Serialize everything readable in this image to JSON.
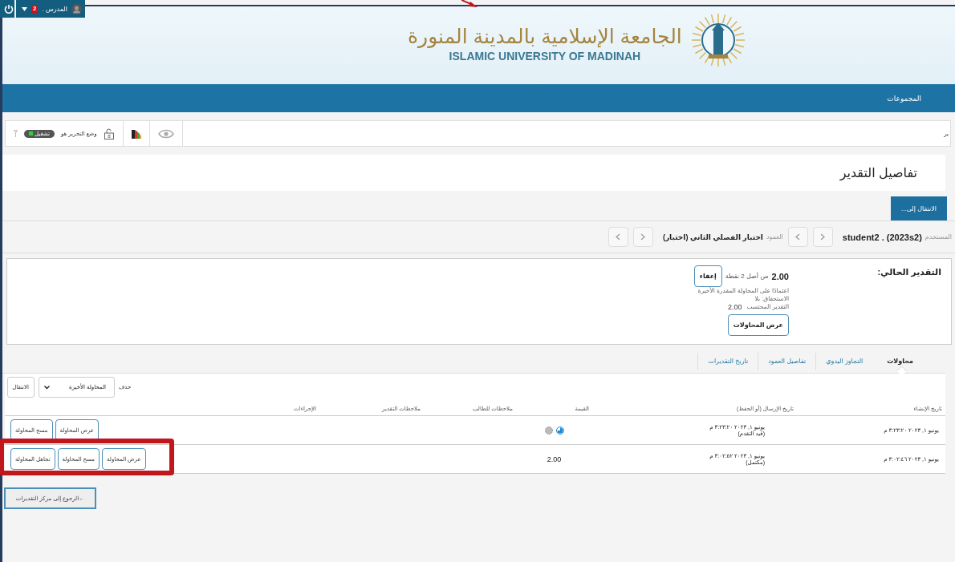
{
  "user_menu": {
    "user_name": "المدرس .",
    "notification_count": "2"
  },
  "logo": {
    "arabic_name": "الجامعة الإسلامية بالمدينة المنورة",
    "english_name": "ISLAMIC UNIVERSITY OF MADINAH"
  },
  "nav": {
    "link": "المجموعات"
  },
  "toolbar": {
    "cut_label": "ير",
    "edit_mode_label": "وضع التحرير هو",
    "edit_mode_toggle": {
      "label": "تشغيل",
      "on": true
    }
  },
  "page_title": "تفاصيل التقدير",
  "jump_button": "الانتقال إلى...",
  "selectors": {
    "user_label": "المستخدم",
    "user_value": "student2 . (2023s2)",
    "column_label": "العمود",
    "column_value": "اختبار الفصلي الثاني (اختبار)"
  },
  "current_grade": {
    "heading": "التقدير الحالي:",
    "score": "2.00",
    "out_of": "من أصل 2 نقطة",
    "exempt_button": "إعفاء",
    "basis": "اعتمادًا على المحاولة المقدرة الأخيرة",
    "due": "الاستحقاق: بلا",
    "calculated_label": "التقدير المحتسب",
    "calculated_value": "2.00",
    "view_attempts_button": "عرض المحاولات"
  },
  "tabs": [
    {
      "label": "محاولات",
      "selected": true
    },
    {
      "label": "التجاوز اليدوي",
      "selected": false
    },
    {
      "label": "تفاصيل العمود",
      "selected": false
    },
    {
      "label": "تاريخ التقديرات",
      "selected": false
    }
  ],
  "filter": {
    "label": "حذف",
    "select_value": "المحاولة الأخيرة",
    "go_button": "الانتقال"
  },
  "table": {
    "columns": [
      "تاريخ الإنشاء",
      "تاريخ الإرسال (أو الحفظ)",
      "القيمة",
      "ملاحظات للطالب",
      "ملاحظات التقدير",
      "الإجراءات"
    ],
    "rows": [
      {
        "created": "يونيو ١, ٢٠٢٣ ٣:٢٣:٢٠ م",
        "submitted": "يونيو ١, ٢٠٢٣ ٣:٢٣:٢٠ م",
        "status": "(قيد التقدم)",
        "value": {
          "kind": "in_progress_icons"
        },
        "actions": [
          "عرض المحاولة",
          "مسح المحاولة"
        ]
      },
      {
        "created": "يونيو ١, ٢٠٢٣ ٣:٠٢:٤٦ م",
        "submitted": "يونيو ١, ٢٠٢٣ ٣:٠٢:٥٢ م",
        "status": "(مكتمل)",
        "value": {
          "kind": "text",
          "text": "2.00"
        },
        "actions": [
          "عرض المحاولة",
          "مسح المحاولة",
          "تجاهل المحاولة"
        ]
      }
    ]
  },
  "back_button": "←الرجوع إلى مركز التقديرات"
}
